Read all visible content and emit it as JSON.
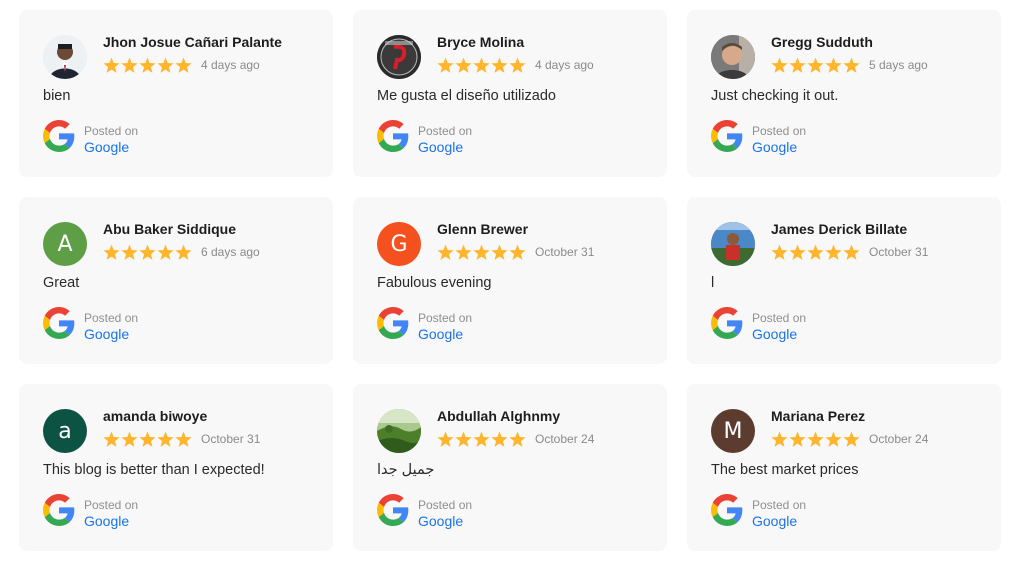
{
  "rating_scale": 5,
  "colors": {
    "star": "#ffb62e",
    "link": "#1a73e8",
    "card_bg": "#f8f8f8"
  },
  "reviews": [
    {
      "author": "Jhon Josue Cañari Palante",
      "rating": 5,
      "date": "4 days ago",
      "text": "bien",
      "posted_on": "Posted on",
      "source": "Google",
      "avatar_type": "photo",
      "avatar_bg": "#e9ecef"
    },
    {
      "author": "Bryce Molina",
      "rating": 5,
      "date": "4 days ago",
      "text": "Me gusta el diseño utilizado",
      "posted_on": "Posted on",
      "source": "Google",
      "avatar_type": "photo",
      "avatar_bg": "#2b2b2b"
    },
    {
      "author": "Gregg Sudduth",
      "rating": 5,
      "date": "5 days ago",
      "text": "Just checking it out.",
      "posted_on": "Posted on",
      "source": "Google",
      "avatar_type": "photo",
      "avatar_bg": "#6b6b6b"
    },
    {
      "author": "Abu Baker Siddique",
      "rating": 5,
      "date": "6 days ago",
      "text": "Great",
      "posted_on": "Posted on",
      "source": "Google",
      "avatar_type": "letter",
      "avatar_letter": "A",
      "avatar_bg": "#5e9e46"
    },
    {
      "author": "Glenn Brewer",
      "rating": 5,
      "date": "October 31",
      "text": "Fabulous evening",
      "posted_on": "Posted on",
      "source": "Google",
      "avatar_type": "letter",
      "avatar_letter": "G",
      "avatar_bg": "#f4511e"
    },
    {
      "author": "James Derick Billate",
      "rating": 5,
      "date": "October 31",
      "text": "l",
      "posted_on": "Posted on",
      "source": "Google",
      "avatar_type": "photo",
      "avatar_bg": "#c0392b"
    },
    {
      "author": "amanda biwoye",
      "rating": 5,
      "date": "October 31",
      "text": "This blog is better than I expected!",
      "posted_on": "Posted on",
      "source": "Google",
      "avatar_type": "letter",
      "avatar_letter": "a",
      "avatar_bg": "#0d5343"
    },
    {
      "author": "Abdullah Alghnmy",
      "rating": 5,
      "date": "October 24",
      "text": "جميل جدا",
      "posted_on": "Posted on",
      "source": "Google",
      "avatar_type": "photo",
      "avatar_bg": "#5e8f3a"
    },
    {
      "author": "Mariana Perez",
      "rating": 5,
      "date": "October 24",
      "text": "The best market prices",
      "posted_on": "Posted on",
      "source": "Google",
      "avatar_type": "letter",
      "avatar_letter": "M",
      "avatar_bg": "#5d3c30"
    }
  ]
}
